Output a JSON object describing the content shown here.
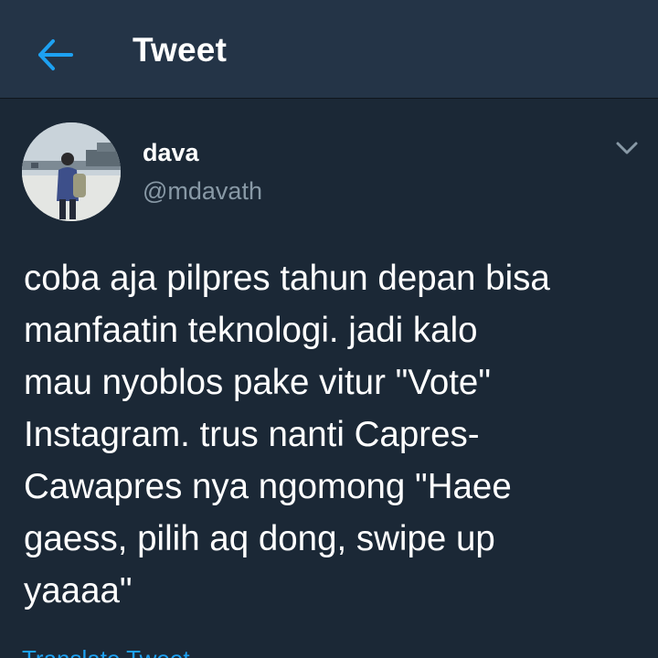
{
  "header": {
    "title": "Tweet",
    "back_icon": "arrow-left-icon",
    "accent_color": "#1da1f2",
    "background_color": "#243447"
  },
  "tweet": {
    "author": {
      "display_name": "dava",
      "handle": "@mdavath",
      "avatar_icon": "user-avatar"
    },
    "menu_icon": "chevron-down-icon",
    "text": "coba aja pilpres tahun depan bisa\nmanfaatin teknologi. jadi kalo\nmau nyoblos pake vitur \"Vote\"\nInstagram. trus nanti Capres-\nCawapres nya ngomong \"Haee\ngaess, pilih aq dong, swipe up\nyaaaa\"",
    "translate_label": "Translate Tweet"
  },
  "colors": {
    "page_background": "#1b2836",
    "secondary_text": "#8899a6",
    "primary_text": "#ffffff"
  }
}
